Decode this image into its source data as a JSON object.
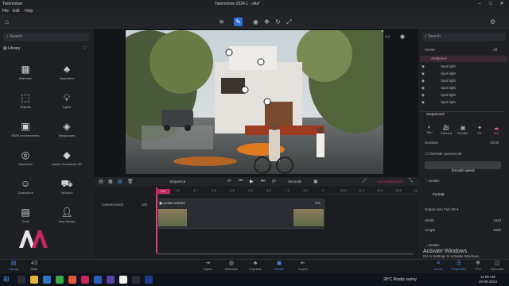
{
  "window": {
    "app_name": "Twinmotion",
    "title": "Twinmotion 2024.1 - villa*",
    "menu": [
      "File",
      "Edit",
      "Help"
    ]
  },
  "left": {
    "search_placeholder": "Search",
    "library_label": "Library",
    "tiles": [
      {
        "label": "Materials",
        "icon": "materials-icon"
      },
      {
        "label": "Vegetation",
        "icon": "vegetation-icon"
      },
      {
        "label": "Objects",
        "icon": "objects-icon"
      },
      {
        "label": "Lights",
        "icon": "lights-icon"
      },
      {
        "label": "HDRI environments",
        "icon": "hdri-icon"
      },
      {
        "label": "Megascans",
        "icon": "megascans-icon"
      },
      {
        "label": "Sketchfab",
        "icon": "sketchfab-icon"
      },
      {
        "label": "Adobe Substance 3D",
        "icon": "substance-icon"
      },
      {
        "label": "Characters",
        "icon": "characters-icon"
      },
      {
        "label": "Vehicles",
        "icon": "vehicles-icon"
      },
      {
        "label": "Tools",
        "icon": "tools-icon"
      },
      {
        "label": "User library",
        "icon": "user-library-icon"
      }
    ]
  },
  "timeline": {
    "sequence_label": "Sequence",
    "seconds_label": "Seconds",
    "clip_label": "Action cam01",
    "track_name": "Camera track",
    "track_fps": "10s",
    "clip_duration": "10s",
    "timecode": "0:0",
    "ruler": [
      "1.6",
      "2.7",
      "3.6",
      "4.5",
      "5.4",
      "6.3",
      "7.2",
      "8.1",
      "9",
      "10.8",
      "11.7",
      "12.6",
      "13.5",
      "14.4"
    ],
    "add_button": "Add media track"
  },
  "right": {
    "search_placeholder": "Search",
    "scene_label": "Scene",
    "all_label": "All",
    "scene_root": "Ambience",
    "scene_items": [
      "Spot light",
      "Spot light",
      "Spot light",
      "Spot light",
      "Spot light",
      "Spot light"
    ],
    "sequence_name": "Sequence4",
    "tabs": [
      "Dim",
      "Camera",
      "Render",
      "FX",
      "Sky"
    ],
    "duration_label": "Duration",
    "duration_value": "10.0s",
    "override_label": "Override camera roll",
    "smooth_speed": "Smooth speed",
    "details_label": "Details",
    "format_label": "Format",
    "output_size_label": "Output size",
    "output_size_value": "Full HD",
    "width_label": "Width",
    "width_value": "1920",
    "height_label": "Height",
    "height_value": "1080",
    "details2_label": "Details"
  },
  "bottom": {
    "tabs_left": [
      {
        "label": "Library"
      },
      {
        "label": "Stats",
        "value": "43"
      }
    ],
    "tabs_center": [
      "Import",
      "Materials",
      "Populate",
      "Media",
      "Export"
    ],
    "tabs_right": [
      "Scene",
      "Properties",
      "XYZ",
      "View sets"
    ],
    "active_center": "Media"
  },
  "watermark": {
    "text": "ACTIVATE WINDOWS",
    "line1": "Activate Windows",
    "line2": "Go to Settings to activate Windows."
  },
  "taskbar": {
    "weather": "28°C  Mostly sunny",
    "time": "11:05 AM",
    "date": "20-06-2024"
  },
  "colors": {
    "accent": "#2f6fd6",
    "clip": "#c2285d",
    "playhead": "#e23a7a"
  }
}
